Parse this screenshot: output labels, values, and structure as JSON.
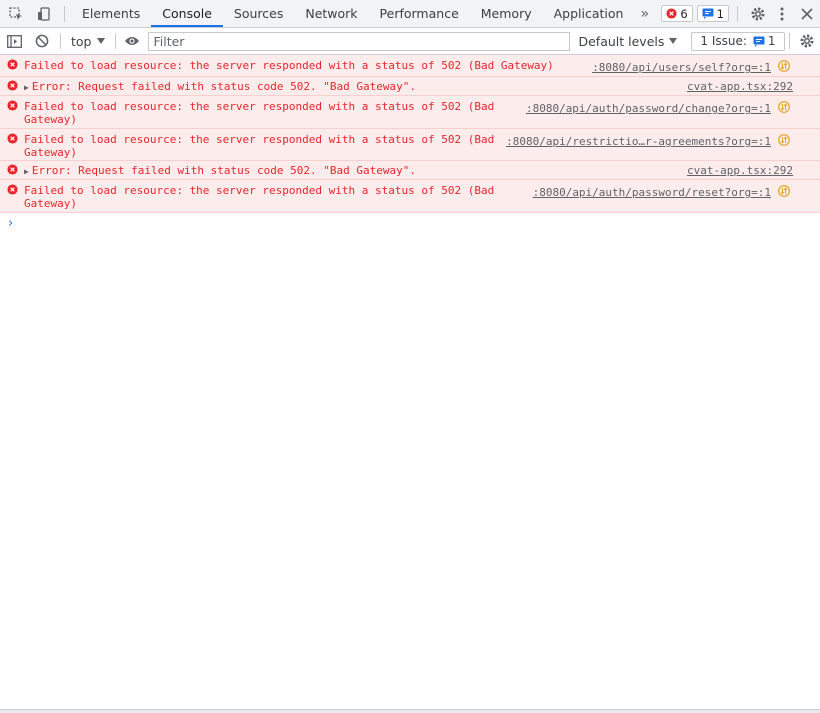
{
  "tabbar": {
    "tabs": [
      {
        "label": "Elements"
      },
      {
        "label": "Console"
      },
      {
        "label": "Sources"
      },
      {
        "label": "Network"
      },
      {
        "label": "Performance"
      },
      {
        "label": "Memory"
      },
      {
        "label": "Application"
      }
    ],
    "more_label": "»",
    "errors_count": "6",
    "messages_count": "1"
  },
  "toolbar": {
    "context": "top",
    "filter_placeholder": "Filter",
    "filter_value": "",
    "levels_label": "Default levels",
    "issues_label": "1 Issue:",
    "issues_count": "1"
  },
  "console": {
    "entries": [
      {
        "text_line1": "Failed to load resource: the server responded with a status of 502 (Bad Gateway)",
        "text_line2": "",
        "source": ":8080/api/users/self?org=:1",
        "expandable": false,
        "has_network_icon": true
      },
      {
        "text_line1": "Error: Request failed with status code 502. \"Bad Gateway\".",
        "text_line2": "",
        "source": "cvat-app.tsx:292",
        "expandable": true,
        "has_network_icon": false
      },
      {
        "text_line1": "Failed to load resource: the server responded with a status of 502 (Bad",
        "text_line2": "Gateway)",
        "source": ":8080/api/auth/password/change?org=:1",
        "expandable": false,
        "has_network_icon": true
      },
      {
        "text_line1": "Failed to load resource: the server responded with a status of 502 (Bad",
        "text_line2": "Gateway)",
        "source": ":8080/api/restrictio…r-agreements?org=:1",
        "expandable": false,
        "has_network_icon": true
      },
      {
        "text_line1": "Error: Request failed with status code 502. \"Bad Gateway\".",
        "text_line2": "",
        "source": "cvat-app.tsx:292",
        "expandable": true,
        "has_network_icon": false
      },
      {
        "text_line1": "Failed to load resource: the server responded with a status of 502 (Bad",
        "text_line2": "Gateway)",
        "source": ":8080/api/auth/password/reset?org=:1",
        "expandable": false,
        "has_network_icon": true
      }
    ],
    "prompt": "›"
  },
  "colors": {
    "error_text": "#e8252b",
    "error_bg": "#fcecec",
    "accent": "#1a73e8",
    "network_icon": "#e8a21b"
  }
}
